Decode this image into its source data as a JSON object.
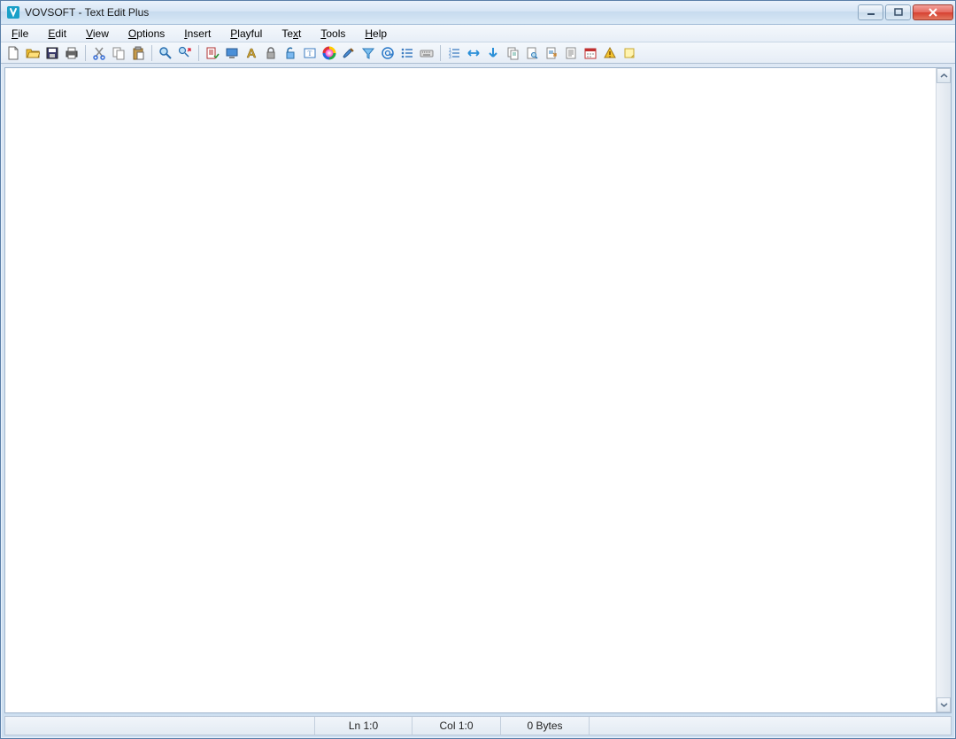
{
  "titlebar": {
    "title": "VOVSOFT - Text Edit Plus"
  },
  "menu": {
    "file": {
      "label": "File",
      "ul": "F"
    },
    "edit": {
      "label": "Edit",
      "ul": "E"
    },
    "view": {
      "label": "View",
      "ul": "V"
    },
    "options": {
      "label": "Options",
      "ul": "O"
    },
    "insert": {
      "label": "Insert",
      "ul": "I"
    },
    "playful": {
      "label": "Playful",
      "ul": "P"
    },
    "text": {
      "label": "Text",
      "ul": "x"
    },
    "tools": {
      "label": "Tools",
      "ul": "T"
    },
    "help": {
      "label": "Help",
      "ul": "H"
    }
  },
  "toolbar_icons": {
    "new": "new-file-icon",
    "open": "open-icon",
    "save": "save-icon",
    "print": "print-icon",
    "cut": "cut-icon",
    "copy": "copy-icon",
    "paste": "paste-icon",
    "find": "find-icon",
    "replace": "replace-icon",
    "spellcheck": "spellcheck-icon",
    "computer": "computer-icon",
    "font": "font-icon",
    "lock": "lock-icon",
    "unlock": "unlock-icon",
    "textbox": "textbox-icon",
    "color": "color-wheel-icon",
    "brush": "brush-icon",
    "filter": "filter-icon",
    "at": "at-sign-icon",
    "list": "list-icon",
    "keyboard": "keyboard-icon",
    "numlist": "numbered-list-icon",
    "left_right": "left-right-arrow-icon",
    "down": "down-arrow-icon",
    "page_copy": "page-copy-icon",
    "page_find": "page-find-icon",
    "page_replace": "page-replace-icon",
    "page_text": "page-text-icon",
    "calendar": "calendar-icon",
    "warning": "warning-icon",
    "note": "note-icon"
  },
  "editor": {
    "content": ""
  },
  "status": {
    "line": "Ln 1:0",
    "col": "Col 1:0",
    "bytes": "0 Bytes"
  }
}
